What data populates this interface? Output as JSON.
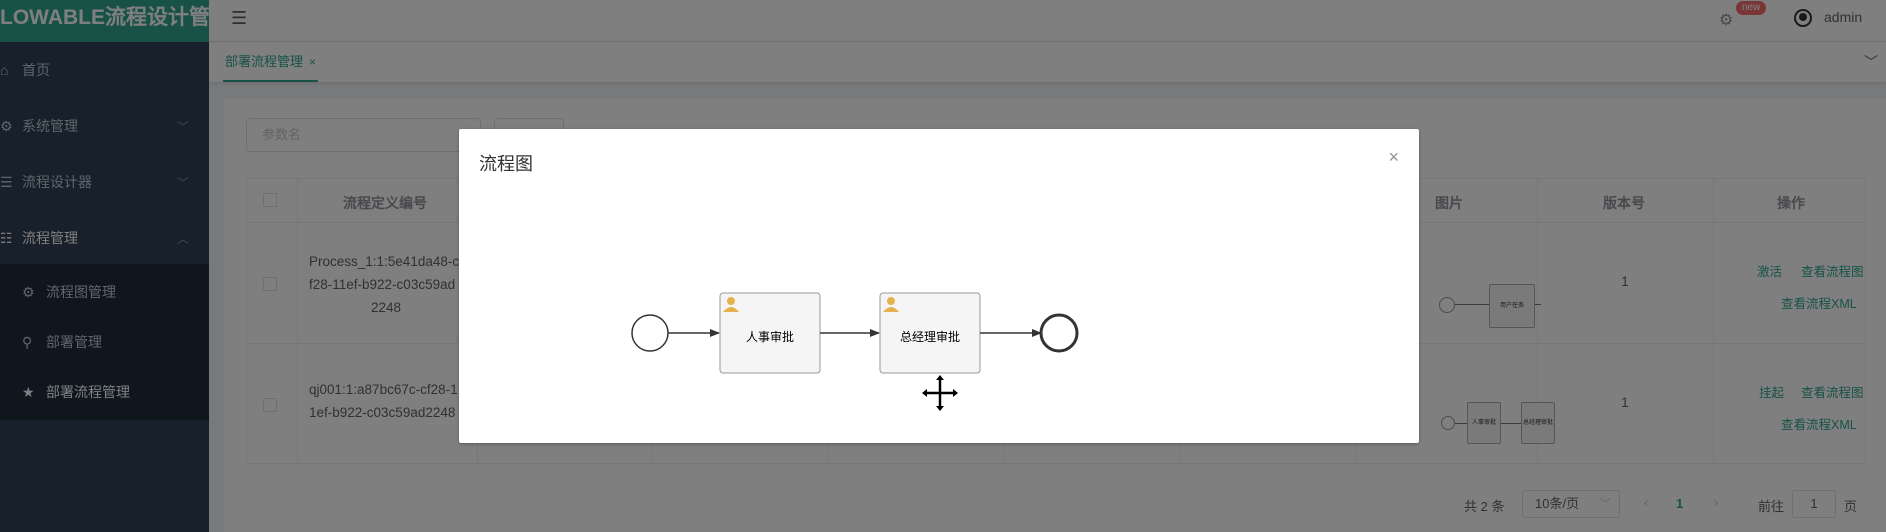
{
  "app": {
    "brand_title": "LOWABLE流程设计管理"
  },
  "sidebar": {
    "items": [
      {
        "label": "首页",
        "icon": "home-icon"
      },
      {
        "label": "系统管理",
        "icon": "gear-icon"
      },
      {
        "label": "流程设计器",
        "icon": "list-icon"
      },
      {
        "label": "流程管理",
        "icon": "menu-icon"
      }
    ],
    "subitems": [
      {
        "label": "流程图管理",
        "icon": "gear-icon"
      },
      {
        "label": "部署管理",
        "icon": "search-icon"
      },
      {
        "label": "部署流程管理",
        "icon": "star-icon"
      }
    ]
  },
  "header": {
    "badge": "new",
    "username": "admin"
  },
  "tabs": {
    "active_label": "部署流程管理",
    "close_glyph": "×"
  },
  "search": {
    "placeholder": "参数名"
  },
  "table": {
    "headers": {
      "def_id": "流程定义编号",
      "image": "图片",
      "version": "版本号",
      "actions": "操作"
    },
    "rows": [
      {
        "def_id_lines": [
          "Process_1:1:5e41da48-c",
          "f28-11ef-b922-c03c59ad",
          "2248"
        ],
        "version": "1",
        "actions": [
          "激活",
          "查看流程图",
          "查看流程XML"
        ],
        "thumb_task": "用户任务"
      },
      {
        "def_id_lines": [
          "qj001:1:a87bc67c-cf28-1",
          "1ef-b922-c03c59ad2248"
        ],
        "version": "1",
        "actions": [
          "挂起",
          "查看流程图",
          "查看流程XML"
        ],
        "thumb_tasks": [
          "人事审批",
          "总经理审批"
        ]
      }
    ]
  },
  "pagination": {
    "total": "共 2 条",
    "page_size": "10条/页",
    "current": "1",
    "goto_label": "前往",
    "goto_value": "1",
    "page_suffix": "页"
  },
  "dialog": {
    "title": "流程图",
    "close_glyph": "×",
    "tasks": [
      "人事审批",
      "总经理审批"
    ]
  },
  "colors": {
    "accent": "#30a58f",
    "sidebar_bg": "#304156",
    "submenu_bg": "#1f2d3d",
    "user_icon": "#e3b24c"
  }
}
